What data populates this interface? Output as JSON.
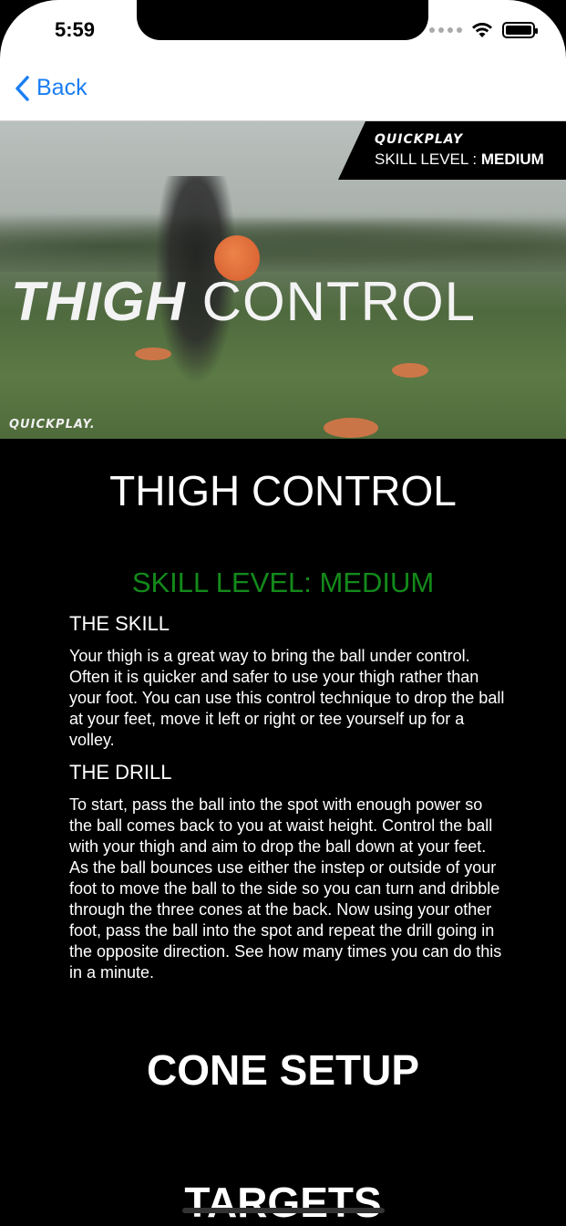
{
  "status_bar": {
    "time": "5:59"
  },
  "nav": {
    "back_label": "Back"
  },
  "hero": {
    "badge_brand": "QUICKPLAY",
    "badge_level_prefix": "SKILL LEVEL : ",
    "badge_level_value": "MEDIUM",
    "title_part1": "THIGH",
    "title_part2": "CONTROL",
    "footer_brand": "QUICKPLAY."
  },
  "content": {
    "title": "THIGH CONTROL",
    "skill_level": "SKILL LEVEL: MEDIUM",
    "skill_heading": "THE SKILL",
    "skill_text": "Your thigh is a great way to bring the ball under control. Often it is quicker and safer to use your thigh rather than your foot. You can use this control technique to drop the ball at your feet, move it left or right or tee yourself up for a volley.",
    "drill_heading": "THE DRILL",
    "drill_text": "To start, pass the ball into the spot with enough power so the ball comes back to you at waist height. Control the ball with your thigh and aim to drop the ball down at your feet. As the ball bounces use either the instep or outside of your foot to move the ball to the side so you can turn and dribble through the three cones at the back. Now using your other foot, pass the ball into the spot and repeat the drill going in the opposite direction. See how many times you can do this in a minute.",
    "cone_setup_heading": "CONE SETUP",
    "targets_heading": "TARGETS"
  },
  "colors": {
    "accent": "#1a7ef3",
    "skill_level": "#138a1a",
    "background": "#000000"
  }
}
